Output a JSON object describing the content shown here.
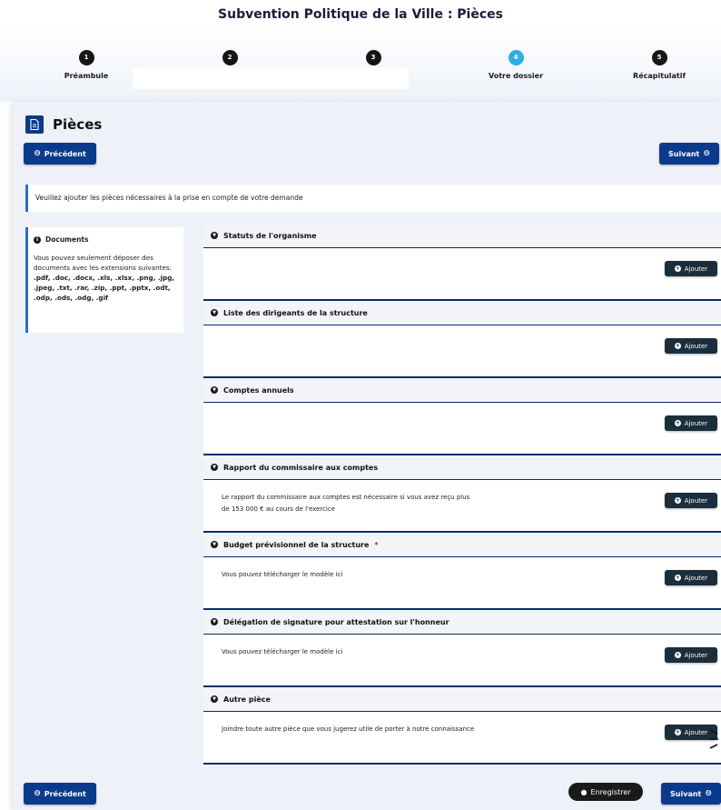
{
  "page": {
    "title": "Subvention Politique de la Ville : Pièces"
  },
  "steps": [
    {
      "number": "1",
      "label": "Préambule",
      "active": false
    },
    {
      "number": "2",
      "label": "",
      "active": false
    },
    {
      "number": "3",
      "label": "",
      "active": false
    },
    {
      "number": "4",
      "label": "Votre dossier",
      "active": true
    },
    {
      "number": "5",
      "label": "Récapitulatif",
      "active": false
    }
  ],
  "header": {
    "title": "Pièces",
    "icon": "document-icon"
  },
  "nav": {
    "previous_label": "Précédent",
    "next_label": "Suivant",
    "save_label": "Enregistrer"
  },
  "notice": "Veuillez ajouter les pièces nécessaires à la prise en compte de votre demande",
  "documents": {
    "title": "Documents",
    "text": "Vous pouvez seulement déposer des documents avec les extensions suivantes:",
    "extensions": ".pdf, .doc, .docx, .xls, .xlsx, .png, .jpg, .jpeg, .txt, .rar, .zip, .ppt, .pptx, .odt, .odp, .ods, .odg, .gif"
  },
  "add_label": "Ajouter",
  "sections": [
    {
      "title": "Statuts de l'organisme",
      "required": "",
      "text": ""
    },
    {
      "title": "Liste des dirigeants de la structure",
      "required": "",
      "text": ""
    },
    {
      "title": "Comptes annuels",
      "required": "",
      "text": ""
    },
    {
      "title": "Rapport du commissaire aux comptes",
      "required": "",
      "text": "Le rapport du commissaire aux comptes est nécessaire si vous avez reçu plus de 153 000 € au cours de l'exercice"
    },
    {
      "title": "Budget prévisionnel de la structure",
      "required": "*",
      "text": "Vous pouvez télécharger le modèle ici"
    },
    {
      "title": "Délégation de signature pour attestation sur l'honneur",
      "required": "",
      "text": "Vous pouvez télécharger le modèle ici"
    },
    {
      "title": "Autre pièce",
      "required": "",
      "text": "Joindre toute autre pièce que vous jugerez utile de porter à notre connaissance"
    }
  ],
  "colors": {
    "primary": "#0b3a8c",
    "active_step": "#2bb0e6",
    "add_button": "#1b2e3c",
    "required": "#d2232a"
  }
}
